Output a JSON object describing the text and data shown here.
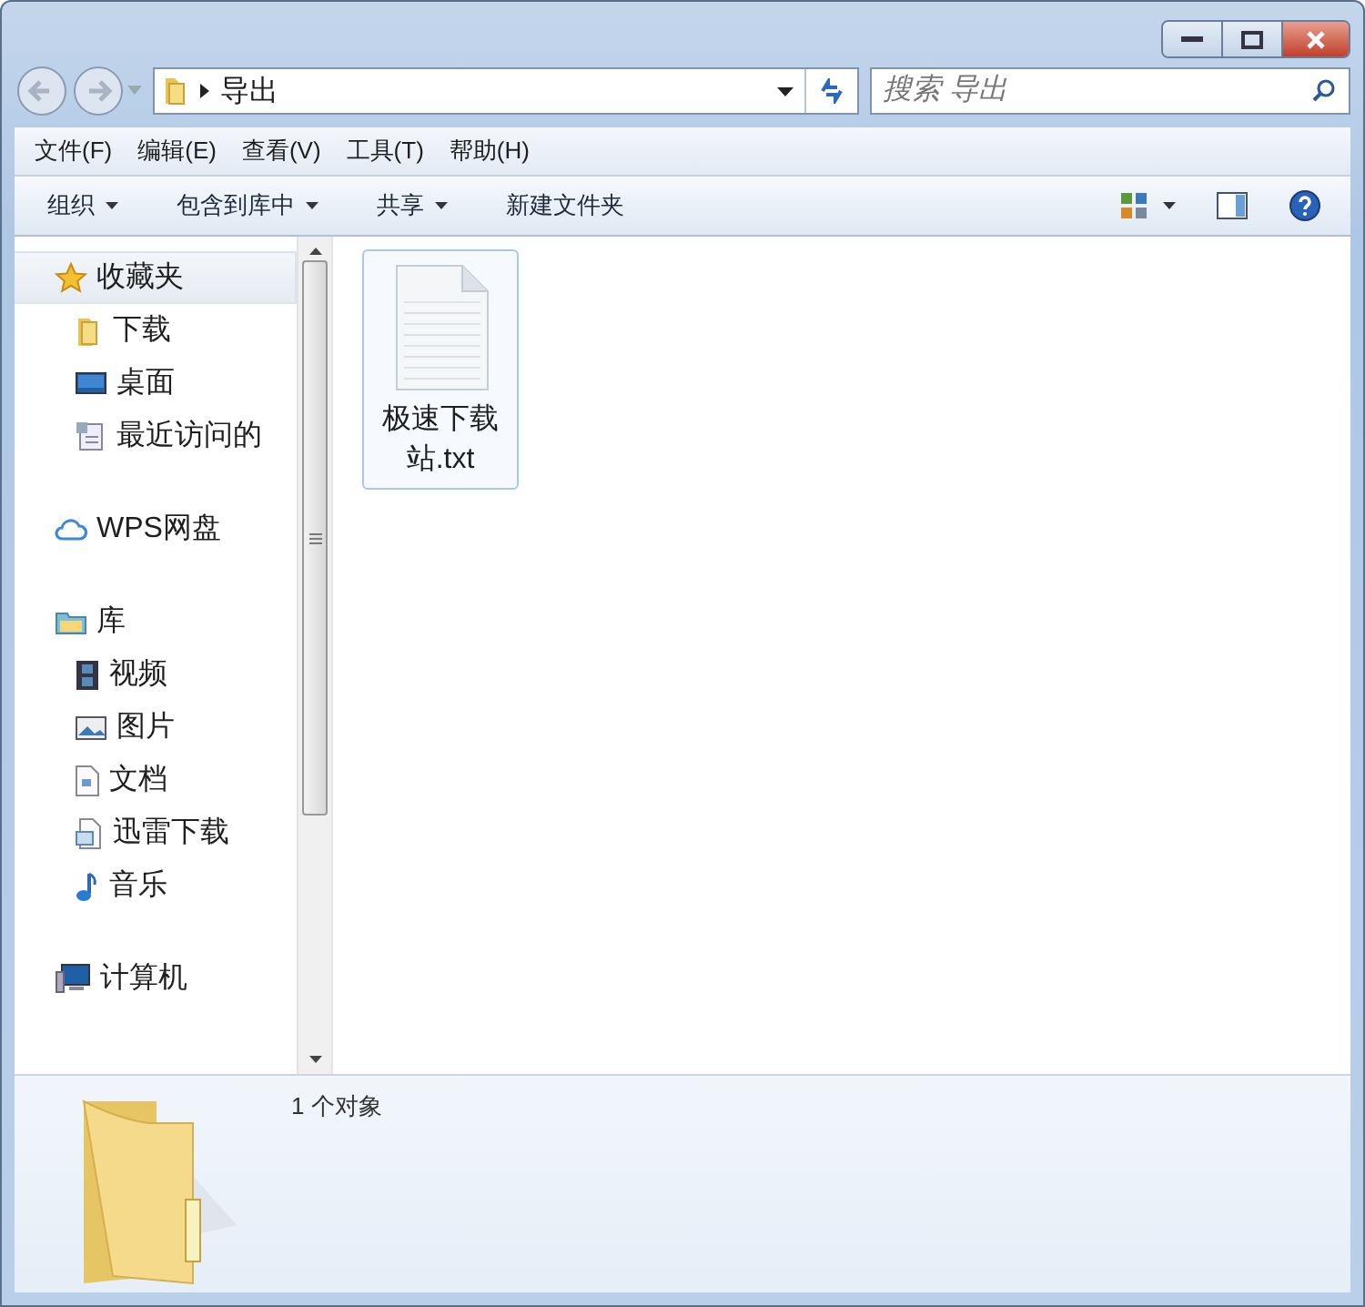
{
  "address": {
    "path": [
      "导出"
    ],
    "search": {
      "placeholder": "搜索 导出"
    }
  },
  "menu": [
    "文件(F)",
    "编辑(E)",
    "查看(V)",
    "工具(T)",
    "帮助(H)"
  ],
  "commands": [
    {
      "label": "组织",
      "dropdown": true
    },
    {
      "label": "包含到库中",
      "dropdown": true
    },
    {
      "label": "共享",
      "dropdown": true
    },
    {
      "label": "新建文件夹",
      "dropdown": false
    }
  ],
  "nav": {
    "groups": [
      {
        "label": "收藏夹",
        "kind": "star",
        "selected": true,
        "children": [
          {
            "label": "下载",
            "kind": "folder",
            "selected": false
          },
          {
            "label": "桌面",
            "kind": "desktop",
            "selected": false
          },
          {
            "label": "最近访问的",
            "kind": "recent",
            "selected": false
          }
        ]
      },
      {
        "label": "WPS网盘",
        "kind": "cloud",
        "selected": false
      },
      {
        "label": "库",
        "kind": "library",
        "selected": false,
        "children": [
          {
            "label": "视频",
            "kind": "video",
            "selected": false
          },
          {
            "label": "图片",
            "kind": "picture",
            "selected": false
          },
          {
            "label": "文档",
            "kind": "document",
            "selected": false
          },
          {
            "label": "迅雷下载",
            "kind": "download",
            "selected": false
          },
          {
            "label": "音乐",
            "kind": "music",
            "selected": false
          }
        ]
      },
      {
        "label": "计算机",
        "kind": "computer",
        "selected": false
      }
    ]
  },
  "files": [
    {
      "name": "极速下载站.txt",
      "kind": "text",
      "selected": true
    }
  ],
  "details": {
    "text": "1 个对象"
  }
}
